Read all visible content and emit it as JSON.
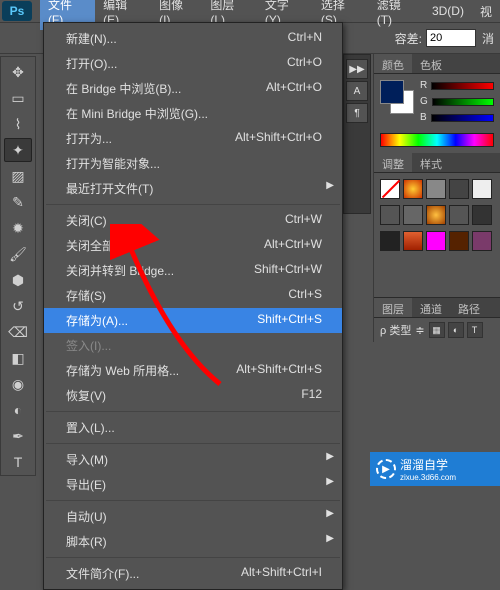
{
  "menubar": {
    "logo": "Ps",
    "items": [
      "文件(F)",
      "编辑(E)",
      "图像(I)",
      "图层(L)",
      "文字(Y)",
      "选择(S)",
      "滤镜(T)",
      "3D(D)",
      "视"
    ],
    "open_index": 0
  },
  "dropdown": {
    "groups": [
      [
        {
          "label": "新建(N)...",
          "shortcut": "Ctrl+N"
        },
        {
          "label": "打开(O)...",
          "shortcut": "Ctrl+O"
        },
        {
          "label": "在 Bridge 中浏览(B)...",
          "shortcut": "Alt+Ctrl+O"
        },
        {
          "label": "在 Mini Bridge 中浏览(G)...",
          "shortcut": ""
        },
        {
          "label": "打开为...",
          "shortcut": "Alt+Shift+Ctrl+O"
        },
        {
          "label": "打开为智能对象...",
          "shortcut": ""
        },
        {
          "label": "最近打开文件(T)",
          "shortcut": "",
          "submenu": true
        }
      ],
      [
        {
          "label": "关闭(C)",
          "shortcut": "Ctrl+W"
        },
        {
          "label": "关闭全部",
          "shortcut": "Alt+Ctrl+W"
        },
        {
          "label": "关闭并转到 Bridge...",
          "shortcut": "Shift+Ctrl+W"
        },
        {
          "label": "存储(S)",
          "shortcut": "Ctrl+S"
        },
        {
          "label": "存储为(A)...",
          "shortcut": "Shift+Ctrl+S",
          "highlighted": true
        },
        {
          "label": "签入(I)...",
          "shortcut": "",
          "disabled": true
        },
        {
          "label": "存储为 Web 所用格...",
          "shortcut": "Alt+Shift+Ctrl+S"
        },
        {
          "label": "恢复(V)",
          "shortcut": "F12"
        }
      ],
      [
        {
          "label": "置入(L)...",
          "shortcut": ""
        }
      ],
      [
        {
          "label": "导入(M)",
          "shortcut": "",
          "submenu": true
        },
        {
          "label": "导出(E)",
          "shortcut": "",
          "submenu": true
        }
      ],
      [
        {
          "label": "自动(U)",
          "shortcut": "",
          "submenu": true
        },
        {
          "label": "脚本(R)",
          "shortcut": "",
          "submenu": true
        }
      ],
      [
        {
          "label": "文件简介(F)...",
          "shortcut": "Alt+Shift+Ctrl+I"
        }
      ]
    ]
  },
  "options": {
    "tolerance_label": "容差:",
    "tolerance_value": "20",
    "anti_alias": "消"
  },
  "right_panels": {
    "color_tabs": [
      "颜色",
      "色板"
    ],
    "rgb_labels": [
      "R",
      "G",
      "B"
    ],
    "adjust_tabs": [
      "调整",
      "样式"
    ],
    "swatch_colors": [
      "#000000",
      "#ff6600",
      "#888888",
      "#444444",
      "#eeeeee",
      "#555555",
      "#666666",
      "#ff8833",
      "#555555",
      "#333333",
      "#222222",
      "#c04020",
      "#ff00ff",
      "#552200",
      "#7a3a6a"
    ],
    "layers_tabs": [
      "图层",
      "通道",
      "路径"
    ],
    "blend_mode_label": "ρ 类型",
    "blend_options": "≑"
  },
  "watermark": {
    "title": "溜溜自学",
    "subtitle": "zixue.3d66.com"
  },
  "vertical_items": [
    "▶▶",
    "A",
    "¶"
  ]
}
